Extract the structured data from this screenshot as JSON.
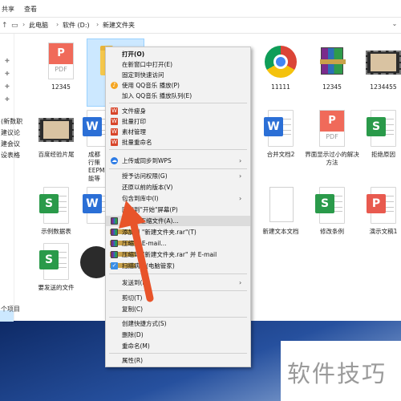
{
  "ribbon": {
    "tabs": [
      "共享",
      "查看"
    ]
  },
  "address": {
    "crumbs": [
      "此电脑",
      "软件 (D:)",
      "新建文件夹"
    ],
    "sep": "›"
  },
  "nav": {
    "side_labels": [
      "(新数职",
      "建议论",
      "建会议",
      "设表格"
    ],
    "status": "个项目"
  },
  "files": [
    {
      "name": "12345",
      "type": "pdf"
    },
    {
      "name": "新",
      "type": "folder",
      "selected": true
    },
    {
      "name": "11111",
      "type": "chrome"
    },
    {
      "name": "12345",
      "type": "rar"
    },
    {
      "name": "1234455",
      "type": "video"
    },
    {
      "name": "百度经验片尾",
      "type": "video"
    },
    {
      "name": "成都\n行策\nEEPM\n能等",
      "type": "word"
    },
    {
      "name": "合并文档2",
      "type": "word"
    },
    {
      "name": "界面显示过小的解决方法",
      "type": "pdf"
    },
    {
      "name": "拒绝原因",
      "type": "excel"
    },
    {
      "name": "示例数据表",
      "type": "excel"
    },
    {
      "name": "新建文本文档",
      "type": "text"
    },
    {
      "name": "修改条例",
      "type": "excel"
    },
    {
      "name": "演示文稿1",
      "type": "ppt"
    },
    {
      "name": "要发送的文件",
      "type": "excel"
    }
  ],
  "context_menu": {
    "items": [
      {
        "label": "打开(O)",
        "bold": true
      },
      {
        "label": "在新窗口中打开(E)"
      },
      {
        "label": "固定到快速访问"
      },
      {
        "label": "使用 QQ音乐 播放(P)",
        "icon": "qq"
      },
      {
        "label": "加入 QQ音乐 播放队列(E)"
      },
      {
        "label": "文件瘦身",
        "icon": "wps"
      },
      {
        "label": "批量打印",
        "icon": "wps"
      },
      {
        "label": "素材管理",
        "icon": "wps"
      },
      {
        "label": "批量重命名",
        "icon": "wps"
      },
      {
        "label": "上传或同步到WPS",
        "icon": "cloud",
        "submenu": true
      },
      {
        "label": "授予访问权限(G)",
        "submenu": true
      },
      {
        "label": "还原以前的版本(V)"
      },
      {
        "label": "包含到库中(I)",
        "submenu": true
      },
      {
        "label": "固定到\"开始\"屏幕(P)"
      },
      {
        "label": "添加到压缩文件(A)...",
        "icon": "rar",
        "hover": true
      },
      {
        "label": "添加到 \"新建文件夹.rar\"(T)",
        "icon": "rar"
      },
      {
        "label": "压缩并 E-mail...",
        "icon": "rar"
      },
      {
        "label": "压缩到 \"新建文件夹.rar\" 并 E-mail",
        "icon": "rar"
      },
      {
        "label": "扫描病毒(电脑管家)",
        "icon": "shield"
      },
      {
        "label": "发送到(N)",
        "submenu": true
      },
      {
        "label": "剪切(T)"
      },
      {
        "label": "复制(C)"
      },
      {
        "label": "创建快捷方式(S)"
      },
      {
        "label": "删除(D)"
      },
      {
        "label": "重命名(M)"
      },
      {
        "label": "属性(R)"
      }
    ]
  },
  "watermark": {
    "text": "软件技巧"
  },
  "colors": {
    "accent_arrow": "#e8542a",
    "selection": "#cce8ff"
  }
}
